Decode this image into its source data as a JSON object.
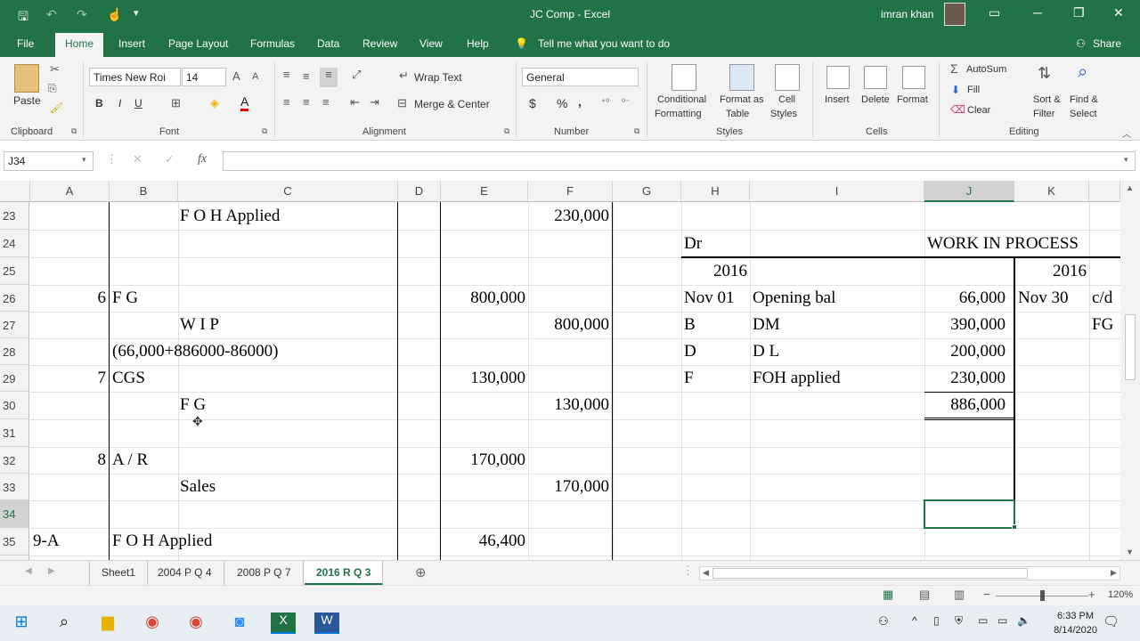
{
  "window": {
    "title": "JC Comp  -  Excel",
    "user": "imran khan"
  },
  "menu": [
    "File",
    "Home",
    "Insert",
    "Page Layout",
    "Formulas",
    "Data",
    "Review",
    "View",
    "Help"
  ],
  "tell_me": "Tell me what you want to do",
  "share": "Share",
  "ribbon": {
    "paste": "Paste",
    "clipboard": "Clipboard",
    "font_name": "Times New Roi",
    "font_size": "14",
    "bold": "B",
    "italic": "I",
    "underline": "U",
    "font": "Font",
    "wrap_text": "Wrap Text",
    "merge_center": "Merge & Center",
    "alignment": "Alignment",
    "number_format": "General",
    "currency": "$",
    "percent": "%",
    "comma": ",",
    "number": "Number",
    "conditional": [
      "Conditional",
      "Formatting"
    ],
    "format_table": [
      "Format as",
      "Table"
    ],
    "cell_styles": [
      "Cell",
      "Styles"
    ],
    "styles": "Styles",
    "insert": "Insert",
    "delete": "Delete",
    "format": "Format",
    "cells": "Cells",
    "autosum": "AutoSum",
    "fill": "Fill",
    "clear": "Clear",
    "sort_filter": [
      "Sort &",
      "Filter"
    ],
    "find_select": [
      "Find &",
      "Select"
    ],
    "editing": "Editing"
  },
  "formula_bar": {
    "name_box": "J34",
    "fx": "fx",
    "formula": ""
  },
  "columns": [
    "A",
    "B",
    "C",
    "D",
    "E",
    "F",
    "G",
    "H",
    "I",
    "J",
    "K"
  ],
  "rows": [
    "23",
    "24",
    "25",
    "26",
    "27",
    "28",
    "29",
    "30",
    "31",
    "32",
    "33",
    "34",
    "35"
  ],
  "cells": {
    "r23": {
      "C": "F O H Applied",
      "F": "230,000"
    },
    "r24": {
      "H": "Dr",
      "J": "WORK IN PROCESS"
    },
    "r25": {
      "H": "2016",
      "K": "2016"
    },
    "r26": {
      "A": "6",
      "B": "F G",
      "E": "800,000",
      "H": "Nov 01",
      "I": "Opening bal",
      "J": "66,000",
      "K": "Nov 30",
      "L": "c/d"
    },
    "r27": {
      "C": "W I P",
      "F": "800,000",
      "H": "B",
      "I": "DM",
      "J": "390,000",
      "L": "FG"
    },
    "r28": {
      "B": "(66,000+886000-86000)",
      "H": "D",
      "I": "D L",
      "J": "200,000"
    },
    "r29": {
      "A": "7",
      "B": "CGS",
      "E": "130,000",
      "H": "F",
      "I": "FOH applied",
      "J": "230,000"
    },
    "r30": {
      "C": "F G",
      "F": "130,000",
      "J": "886,000"
    },
    "r32": {
      "A": "8",
      "B": "A / R",
      "E": "170,000"
    },
    "r33": {
      "C": "Sales",
      "F": "170,000"
    },
    "r35": {
      "A": "9-A",
      "B": "F O H Applied",
      "E": "46,400"
    }
  },
  "sheets": [
    "Sheet1",
    "2004 P Q 4",
    "2008 P Q 7",
    "2016 R Q 3"
  ],
  "zoom": "120%",
  "clock": {
    "time": "6:33 PM",
    "date": "8/14/2020"
  }
}
